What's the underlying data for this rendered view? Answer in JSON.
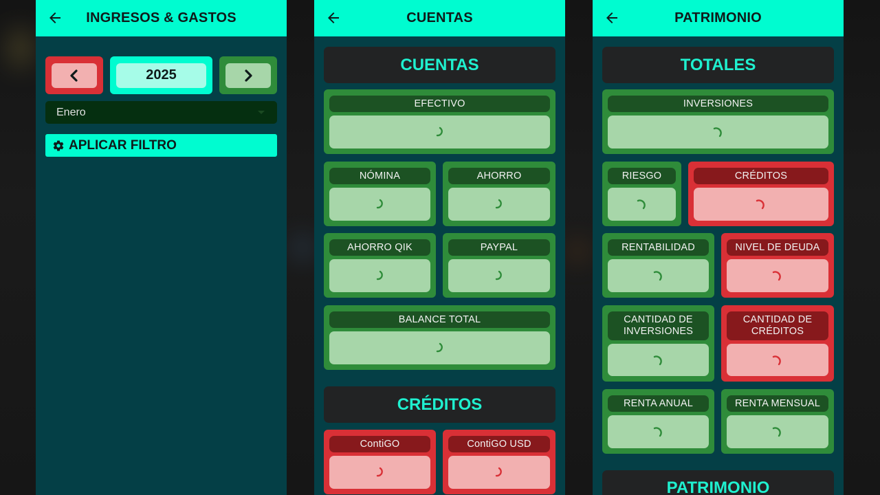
{
  "screens": {
    "ingresos": {
      "title": "INGRESOS & GASTOS",
      "year": "2025",
      "month": "Enero",
      "filter_button": "APLICAR FILTRO"
    },
    "cuentas": {
      "title": "CUENTAS",
      "section_cuentas": "CUENTAS",
      "cards": [
        {
          "label": "EFECTIVO"
        },
        {
          "label": "NÓMINA"
        },
        {
          "label": "AHORRO"
        },
        {
          "label": "AHORRO QIK"
        },
        {
          "label": "PAYPAL"
        },
        {
          "label": "BALANCE TOTAL"
        }
      ],
      "section_creditos": "CRÉDITOS",
      "credit_cards": [
        {
          "label": "ContiGO"
        },
        {
          "label": "ContiGO USD"
        }
      ]
    },
    "patrimonio": {
      "title": "PATRIMONIO",
      "section_totales": "TOTALES",
      "cards": [
        {
          "label": "INVERSIONES"
        },
        {
          "label": "RIESGO"
        },
        {
          "label": "CRÉDITOS"
        },
        {
          "label": "RENTABILIDAD"
        },
        {
          "label": "NIVEL DE DEUDA"
        },
        {
          "label": "CANTIDAD DE\nINVERSIONES"
        },
        {
          "label": "CANTIDAD DE\nCRÉDITOS"
        },
        {
          "label": "RENTA ANUAL"
        },
        {
          "label": "RENTA MENSUAL"
        }
      ],
      "section_patrimonio": "PATRIMONIO"
    }
  },
  "colors": {
    "accent": "#00fcd0",
    "background": "#043f46",
    "positive": "#2f8c3a",
    "negative": "#d93036"
  },
  "icons": [
    "back-arrow-icon",
    "chevron-left-icon",
    "chevron-right-icon",
    "caret-down-icon",
    "gear-icon",
    "loading-spinner-icon"
  ]
}
